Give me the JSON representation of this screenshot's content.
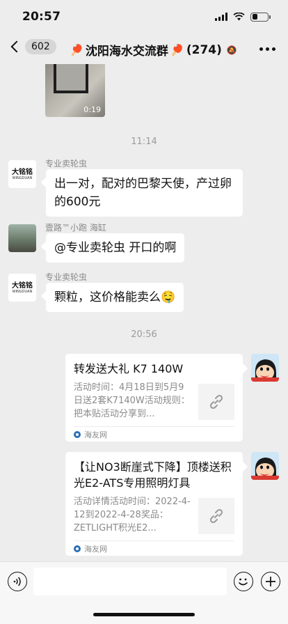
{
  "status": {
    "time": "20:57",
    "battery_level": 0.35
  },
  "nav": {
    "unread_count": "602",
    "group_name": "沈阳海水交流群",
    "member_count": "(274)",
    "title_icon": "ping-pong-paddle"
  },
  "messages": {
    "video": {
      "duration": "0:19"
    },
    "time_1": "11:14",
    "msg1": {
      "sender": "专业卖轮虫",
      "avatar_text": "大铭铭",
      "avatar_sub": "WINGDUAN",
      "text": "出一对，配对的巴黎天使，产过卵的600元"
    },
    "msg2": {
      "sender": "壹路™小跑 海缸",
      "text": "@专业卖轮虫 开口的啊"
    },
    "msg3": {
      "sender": "专业卖轮虫",
      "avatar_text": "大铭铭",
      "avatar_sub": "WINGDUAN",
      "text": "颗粒，这价格能卖么",
      "emoji": "🤤"
    },
    "time_2": "20:56",
    "card1": {
      "title": "转发送大礼 K7 140W",
      "desc": "活动时间：4月18日到5月9日送2套K7140W活动规则：把本贴活动分享到...",
      "source": "海友网"
    },
    "card2": {
      "title": "【让NO3断崖式下降】顶楼送积光E2-ATS专用照明灯具",
      "desc": "活动详情活动时间：2022-4-12到2022-4-28奖品：ZETLIGHT积光E2...",
      "source": "海友网"
    }
  },
  "input": {
    "placeholder": ""
  }
}
